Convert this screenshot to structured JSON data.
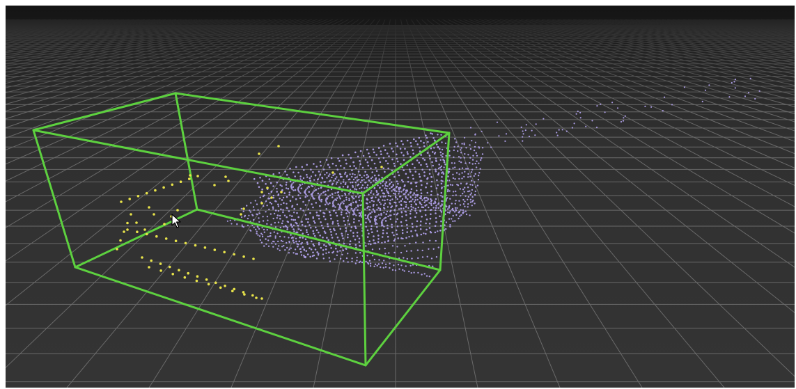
{
  "viewer": {
    "scene": "3d-point-cloud-viewport",
    "colors": {
      "background_top": "#141414",
      "background_bottom": "#333333",
      "grid_line": "#6a6a6a",
      "bounding_box": "#5dd13f",
      "object_points": "#a99ae0",
      "highlighted_points": "#e8e34a"
    },
    "icons": [
      "mouse-pointer-icon"
    ]
  }
}
